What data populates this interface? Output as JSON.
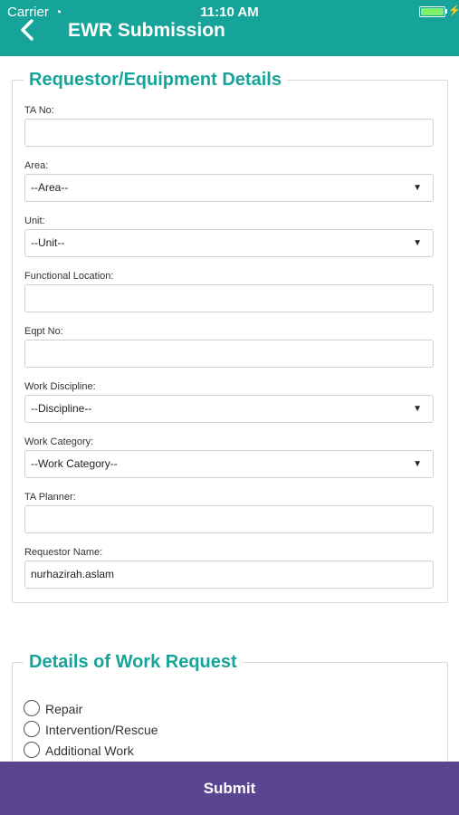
{
  "status_bar": {
    "carrier": "Carrier",
    "time": "11:10 AM"
  },
  "nav": {
    "title": "EWR Submission"
  },
  "section1": {
    "legend": "Requestor/Equipment Details",
    "fields": {
      "ta_no": {
        "label": "TA No:",
        "value": ""
      },
      "area": {
        "label": "Area:",
        "selected": "--Area--"
      },
      "unit": {
        "label": "Unit:",
        "selected": "--Unit--"
      },
      "functional_location": {
        "label": "Functional Location:",
        "value": ""
      },
      "eqpt_no": {
        "label": "Eqpt No:",
        "value": ""
      },
      "work_discipline": {
        "label": "Work Discipline:",
        "selected": "--Discipline--"
      },
      "work_category": {
        "label": "Work Category:",
        "selected": "--Work Category--"
      },
      "ta_planner": {
        "label": "TA Planner:",
        "value": ""
      },
      "requestor_name": {
        "label": "Requestor Name:",
        "value": "nurhazirah.aslam"
      }
    }
  },
  "section2": {
    "legend": "Details of Work Request",
    "options": [
      "Repair",
      "Intervention/Rescue",
      "Additional Work"
    ]
  },
  "submit_label": "Submit",
  "colors": {
    "header": "#16a39a",
    "accent": "#16a39a",
    "submit": "#5b4590"
  }
}
